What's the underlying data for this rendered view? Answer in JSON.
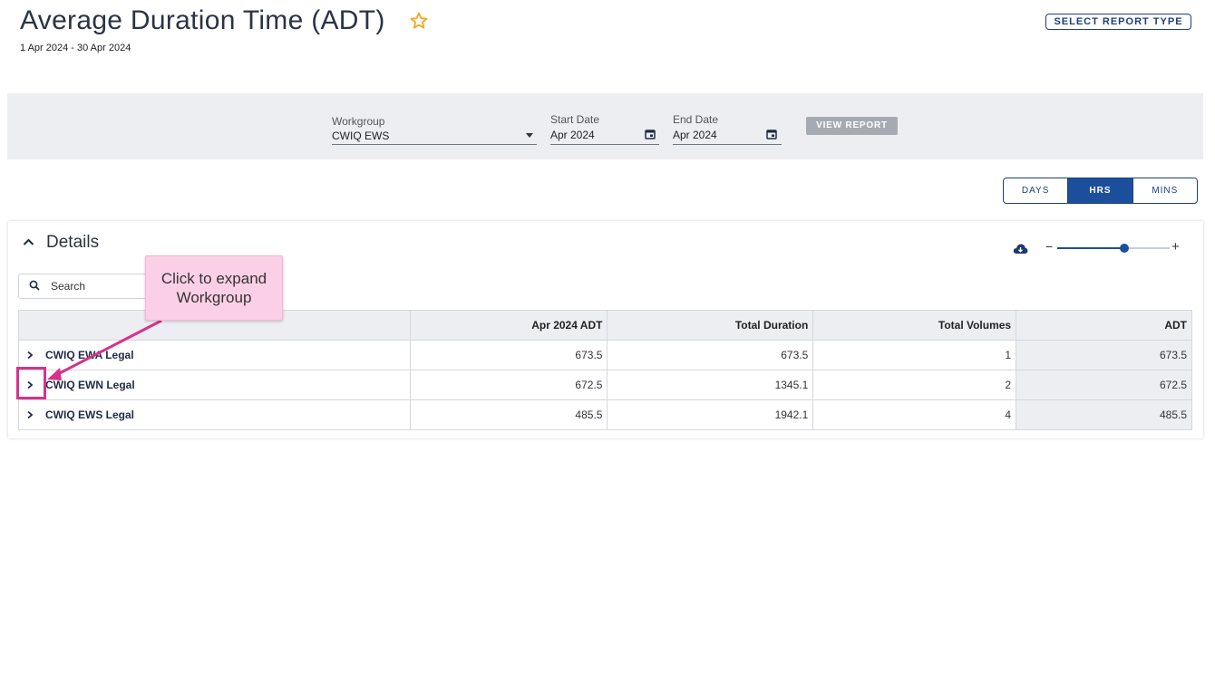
{
  "header": {
    "title": "Average Duration Time (ADT)",
    "date_range": "1 Apr 2024 - 30 Apr 2024",
    "select_report_type_label": "SELECT REPORT TYPE",
    "favorite_icon": "star-outline-icon",
    "favorite_color": "#f5a623"
  },
  "filters": {
    "workgroup_label": "Workgroup",
    "workgroup_value": "CWIQ EWS",
    "start_date_label": "Start Date",
    "start_date_value": "Apr 2024",
    "end_date_label": "End Date",
    "end_date_value": "Apr 2024",
    "view_report_label": "VIEW REPORT"
  },
  "unit_toggle": {
    "options": [
      "DAYS",
      "HRS",
      "MINS"
    ],
    "selected": "HRS"
  },
  "details": {
    "title": "Details",
    "search_placeholder": "Search",
    "zoom_level": 0.6,
    "download_icon": "cloud-download-icon",
    "columns": [
      "",
      "Apr 2024 ADT",
      "Total Duration",
      "Total Volumes",
      "ADT"
    ],
    "rows": [
      {
        "name": "CWIQ EWA Legal",
        "apr_adt": "673.5",
        "total_duration": "673.5",
        "total_volumes": "1",
        "adt": "673.5"
      },
      {
        "name": "CWIQ EWN Legal",
        "apr_adt": "672.5",
        "total_duration": "1345.1",
        "total_volumes": "2",
        "adt": "672.5"
      },
      {
        "name": "CWIQ EWS Legal",
        "apr_adt": "485.5",
        "total_duration": "1942.1",
        "total_volumes": "4",
        "adt": "485.5"
      }
    ]
  },
  "annotation": {
    "callout_text": "Click to expand Workgroup",
    "color": "#d6338a"
  },
  "colors": {
    "primary": "#1b4f9c",
    "filter_bar_bg": "#eceef1"
  }
}
